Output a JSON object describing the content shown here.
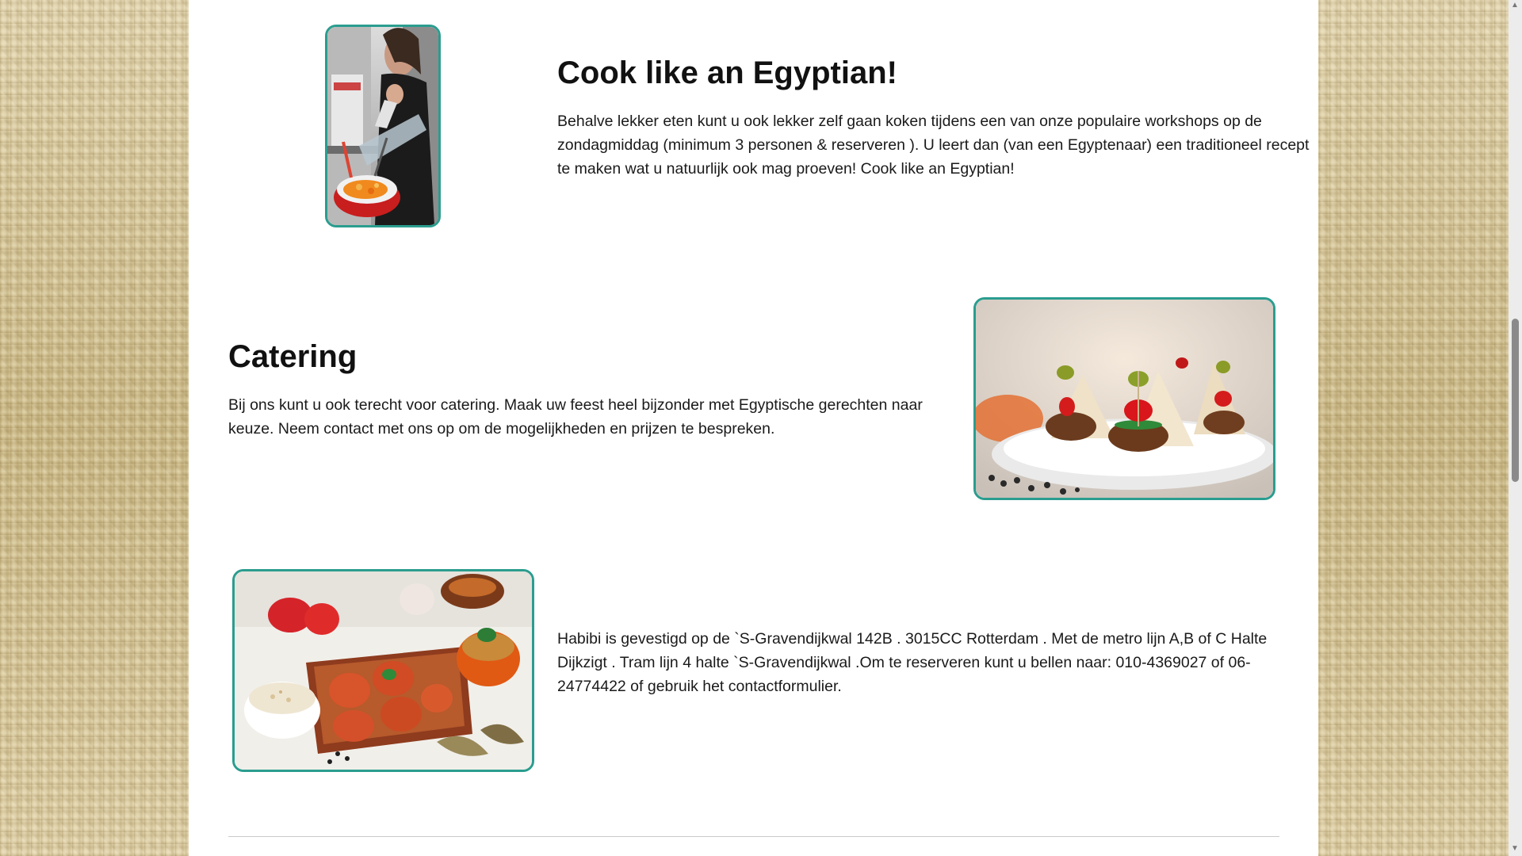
{
  "sections": [
    {
      "title": "Cook like an Egyptian!",
      "text": "Behalve lekker eten kunt u ook lekker zelf gaan koken tijdens een van onze populaire workshops op de zondagmiddag (minimum 3 personen & reserveren ). U leert dan (van een Egyptenaar) een traditioneel recept te maken wat u natuurlijk ook mag proeven! Cook like an Egyptian!",
      "image": "cooking-workshop-photo"
    },
    {
      "title": "Catering",
      "text": "Bij ons kunt u ook terecht voor catering. Maak uw feest heel bijzonder met Egyptische gerechten naar keuze. Neem contact met ons op om de mogelijkheden en prijzen te bespreken.",
      "image": "catering-appetizers-photo"
    },
    {
      "title": "",
      "text": "Habibi is gevestigd op de `S-Gravendijkwal 142B . 3015CC Rotterdam . Met de metro lijn A,B of C Halte Dijkzigt . Tram lijn 4 halte `S-Gravendijkwal .Om te reserveren kunt u bellen naar: 010-4369027 of 06-24774422 of gebruik het contactformulier.",
      "image": "egyptian-dishes-photo"
    }
  ],
  "colors": {
    "image_border": "#2a9d8f",
    "page_background": "#ffffff",
    "side_texture": "#d8c9a0"
  }
}
